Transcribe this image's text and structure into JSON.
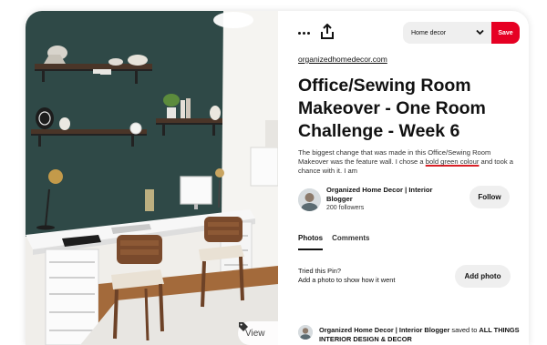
{
  "toolbar": {
    "more_icon": "more-icon",
    "share_icon": "share-icon",
    "board_select": "Home decor",
    "save_label": "Save",
    "accent_color": "#e60023"
  },
  "pin": {
    "source_link": "organizedhomedecor.com",
    "title": "Office/Sewing Room Makeover - One Room Challenge - Week 6",
    "description_before": "The biggest change that was made in this Office/Sewing Room Makeover was the feature wall. I chose a ",
    "description_highlight": "bold green colour",
    "description_after": " and took a chance with it. I am"
  },
  "creator": {
    "name": "Organized Home Decor | Interior Blogger",
    "followers": "200 followers",
    "follow_label": "Follow"
  },
  "tabs": [
    {
      "label": "Photos",
      "active": true
    },
    {
      "label": "Comments",
      "active": false
    }
  ],
  "tried": {
    "title": "Tried this Pin?",
    "subtitle": "Add a photo to show how it went",
    "button_label": "Add photo"
  },
  "activity": {
    "user": "Organized Home Decor | Interior Blogger",
    "verb": " saved to ",
    "board": "ALL THINGS INTERIOR DESIGN & DECOR"
  },
  "photo": {
    "visit_label": "View",
    "wall_color": "#2f4947"
  }
}
